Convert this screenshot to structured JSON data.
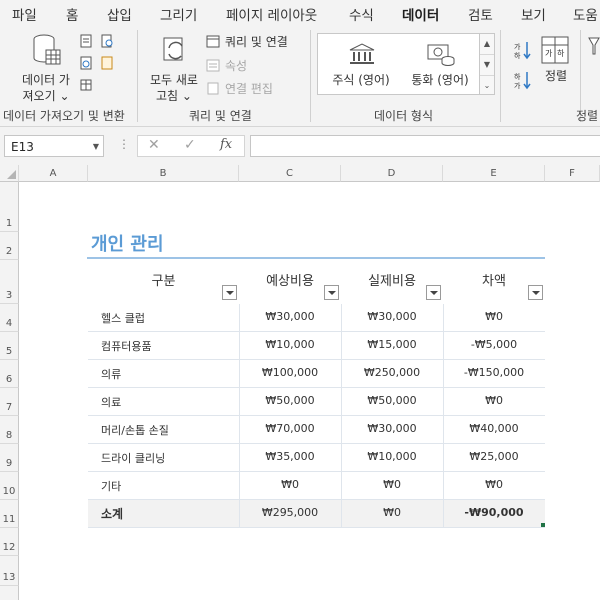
{
  "menu": {
    "tabs": [
      "파일",
      "홈",
      "삽입",
      "그리기",
      "페이지 레이아웃",
      "수식",
      "데이터",
      "검토",
      "보기",
      "도움"
    ],
    "active_tab": "데이터"
  },
  "ribbon": {
    "get_data": {
      "line1": "데이터 가",
      "line2": "져오기",
      "group_label": "데이터 가져오기 및 변환"
    },
    "refresh_all": {
      "line1": "모두 새로",
      "line2": "고침"
    },
    "queries_connections": "쿼리 및 연결",
    "properties": "속성",
    "edit_links": "연결 편집",
    "queries_group_label": "쿼리 및 연결",
    "data_types": {
      "stocks": "주식 (영어)",
      "currency": "통화 (영어)",
      "group_label": "데이터 형식"
    },
    "sort_label": "정렬",
    "sort_group_label": "정렬",
    "sort_az": "가↓하",
    "sort_za": "하↓가"
  },
  "formula_bar": {
    "name_box": "E13",
    "cancel": "✕",
    "enter": "✓",
    "fx": "fx",
    "formula": ""
  },
  "columns": [
    "A",
    "B",
    "C",
    "D",
    "E",
    "F"
  ],
  "rows": [
    "1",
    "2",
    "3",
    "4",
    "5",
    "6",
    "7",
    "8",
    "9",
    "10",
    "11",
    "12",
    "13"
  ],
  "sheet": {
    "title": "개인 관리",
    "headers": [
      "구분",
      "예상비용",
      "실제비용",
      "차액"
    ],
    "items": [
      {
        "name": "헬스 클럽",
        "expected": "₩30,000",
        "actual": "₩30,000",
        "diff": "₩0"
      },
      {
        "name": "컴퓨터용품",
        "expected": "₩10,000",
        "actual": "₩15,000",
        "diff": "-₩5,000"
      },
      {
        "name": "의류",
        "expected": "₩100,000",
        "actual": "₩250,000",
        "diff": "-₩150,000"
      },
      {
        "name": "의료",
        "expected": "₩50,000",
        "actual": "₩50,000",
        "diff": "₩0"
      },
      {
        "name": "머리/손톱 손질",
        "expected": "₩70,000",
        "actual": "₩30,000",
        "diff": "₩40,000"
      },
      {
        "name": "드라이 클리닝",
        "expected": "₩35,000",
        "actual": "₩10,000",
        "diff": "₩25,000"
      },
      {
        "name": "기타",
        "expected": "₩0",
        "actual": "₩0",
        "diff": "₩0"
      }
    ],
    "total": {
      "name": "소계",
      "expected": "₩295,000",
      "actual": "₩0",
      "diff": "-₩90,000"
    }
  },
  "colors": {
    "accent": "#217346",
    "title": "#5b9bd5",
    "rule": "#9dc3e6"
  }
}
